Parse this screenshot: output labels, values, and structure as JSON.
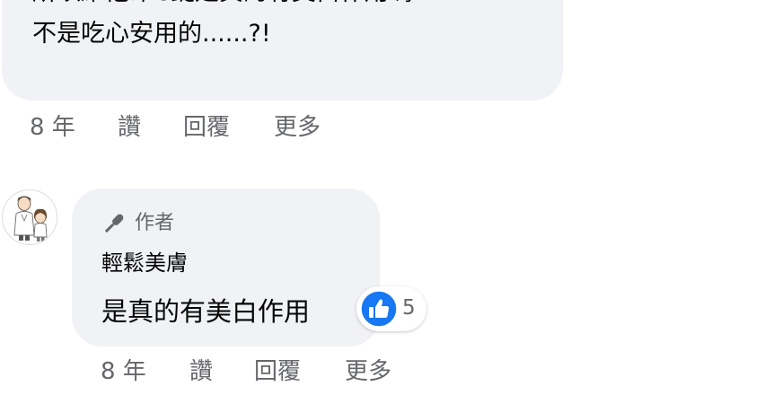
{
  "comment1": {
    "line1": "所以維他命C錠是真的有美白作用嗎?",
    "line2": "不是吃心安用的......?!",
    "actions": {
      "time": "8 年",
      "like": "讚",
      "reply": "回覆",
      "more": "更多"
    }
  },
  "reply": {
    "author_badge": "作者",
    "author_name": "輕鬆美膚",
    "text": "是真的有美白作用",
    "reaction_count": "5",
    "reaction_icon": "thumbs-up-icon",
    "actions": {
      "time": "8 年",
      "like": "讚",
      "reply": "回覆",
      "more": "更多"
    }
  },
  "colors": {
    "bubble": "#f0f2f5",
    "text": "#050505",
    "secondary": "#65676b",
    "like_blue": "#1877f2"
  }
}
